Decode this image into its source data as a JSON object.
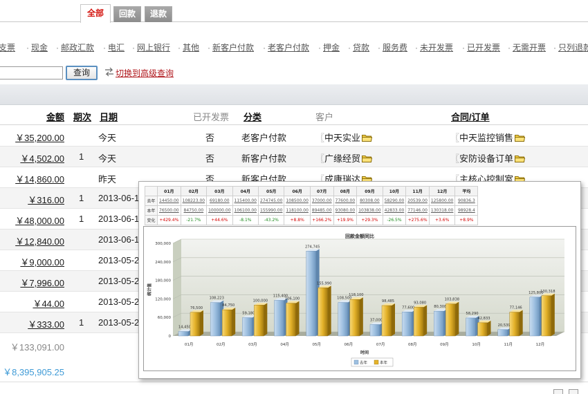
{
  "tabs": [
    {
      "label": "全部",
      "active": true
    },
    {
      "label": "回款",
      "active": false
    },
    {
      "label": "退款",
      "active": false
    }
  ],
  "filters": [
    "支票",
    "现金",
    "邮政汇款",
    "电汇",
    "网上银行",
    "其他",
    "新客户付款",
    "老客户付款",
    "押金",
    "贷款",
    "服务费",
    "未开发票",
    "已开发票",
    "无需开票",
    "只列退款"
  ],
  "search": {
    "value": "",
    "button_label": "查询",
    "advanced_label": "切换到高级查询"
  },
  "table": {
    "headers": {
      "amount": "金额",
      "period": "期次",
      "date": "日期",
      "invoiced": "已开发票",
      "category": "分类",
      "customer": "客户",
      "contract": "合同/订单"
    },
    "rows": [
      {
        "amount": "￥35,200.00",
        "period": "",
        "date": "今天",
        "invoiced": "否",
        "category": "老客户付款",
        "customer": "中天实业",
        "contract": "中天监控销售"
      },
      {
        "amount": "￥4,502.00",
        "period": "1",
        "date": "今天",
        "invoiced": "否",
        "category": "新客户付款",
        "customer": "广缘经贸",
        "contract": "安防设备订单"
      },
      {
        "amount": "￥14,860.00",
        "period": "",
        "date": "昨天",
        "invoiced": "否",
        "category": "新客户付款",
        "customer": "成康瑞达",
        "contract": "主核心控制室"
      },
      {
        "amount": "￥316.00",
        "period": "1",
        "date": "2013-06-1",
        "invoiced": "",
        "category": "",
        "customer": "",
        "contract": ""
      },
      {
        "amount": "￥48,000.00",
        "period": "1",
        "date": "2013-06-1",
        "invoiced": "",
        "category": "",
        "customer": "",
        "contract": ""
      },
      {
        "amount": "￥12,840.00",
        "period": "",
        "date": "2013-06-1",
        "invoiced": "",
        "category": "",
        "customer": "",
        "contract": ""
      },
      {
        "amount": "￥9,000.00",
        "period": "",
        "date": "2013-05-2",
        "invoiced": "",
        "category": "",
        "customer": "",
        "contract": ""
      },
      {
        "amount": "￥7,996.00",
        "period": "",
        "date": "2013-05-2",
        "invoiced": "",
        "category": "",
        "customer": "",
        "contract": ""
      },
      {
        "amount": "￥44.00",
        "period": "",
        "date": "2013-05-2",
        "invoiced": "",
        "category": "",
        "customer": "",
        "contract": ""
      },
      {
        "amount": "￥333.00",
        "period": "1",
        "date": "2013-05-2",
        "invoiced": "",
        "category": "",
        "customer": "",
        "contract": ""
      }
    ],
    "page_total": "￥133,091.00",
    "grand_total": "￥8,395,905.25"
  },
  "popup": {
    "stats_table": {
      "months": [
        "01月",
        "02月",
        "03月",
        "04月",
        "05月",
        "06月",
        "07月",
        "08月",
        "09月",
        "10月",
        "11月",
        "12月",
        "平均"
      ],
      "rows": [
        {
          "label": "去年",
          "values": [
            "14450.00",
            "108223.00",
            "69180.00",
            "115400.00",
            "274745.00",
            "108500.00",
            "37000.00",
            "77600.00",
            "80308.00",
            "58290.00",
            "20539.00",
            "125800.00",
            "90836.3"
          ]
        },
        {
          "label": "本年",
          "values": [
            "76500.00",
            "84750.00",
            "100000.00",
            "106100.00",
            "155990.00",
            "118100.00",
            "89485.00",
            "93080.00",
            "103838.00",
            "42833.00",
            "77146.00",
            "130318.00",
            "98928.4"
          ]
        },
        {
          "label": "变化",
          "values": [
            "+429.4%",
            "-21.7%",
            "+44.6%",
            "-8.1%",
            "-43.2%",
            "+8.8%",
            "+166.2%",
            "+19.9%",
            "+29.3%",
            "-26.5%",
            "+275.6%",
            "+3.6%",
            "+8.9%"
          ]
        }
      ]
    }
  },
  "chart_data": {
    "type": "bar",
    "title": "回款金额同比",
    "xlabel": "时间",
    "ylabel": "统计值",
    "categories": [
      "01月",
      "02月",
      "03月",
      "04月",
      "05月",
      "06月",
      "07月",
      "08月",
      "09月",
      "10月",
      "11月",
      "12月"
    ],
    "series": [
      {
        "name": "去年",
        "color": "#9dbfe0",
        "values": [
          14450,
          108223,
          59180,
          115400,
          274745,
          108500,
          37000,
          77600,
          80308,
          58290,
          20539,
          125800
        ]
      },
      {
        "name": "本年",
        "color": "#e4b22a",
        "values": [
          76500,
          84750,
          100000,
          106100,
          155990,
          118100,
          98485,
          93080,
          103838,
          42833,
          77146,
          130318
        ]
      }
    ],
    "data_labels": [
      [
        "14,450",
        "108,223",
        "59,180",
        "115,400",
        "274,745",
        "108,500",
        "37,000",
        "77,600",
        "80,308",
        "58,290",
        "20,539",
        "125,800"
      ],
      [
        "76,500",
        "84,750",
        "100,000",
        "106,100",
        "155,990",
        "118,100",
        "98,485",
        "93,080",
        "103,838",
        "42,833",
        "77,146",
        "130,318"
      ]
    ],
    "y_ticks": [
      "0",
      "60,000",
      "120,000",
      "180,000",
      "240,000",
      "300,000"
    ],
    "ylim": [
      0,
      300000
    ],
    "legend_position": "bottom-center",
    "grid": true
  }
}
